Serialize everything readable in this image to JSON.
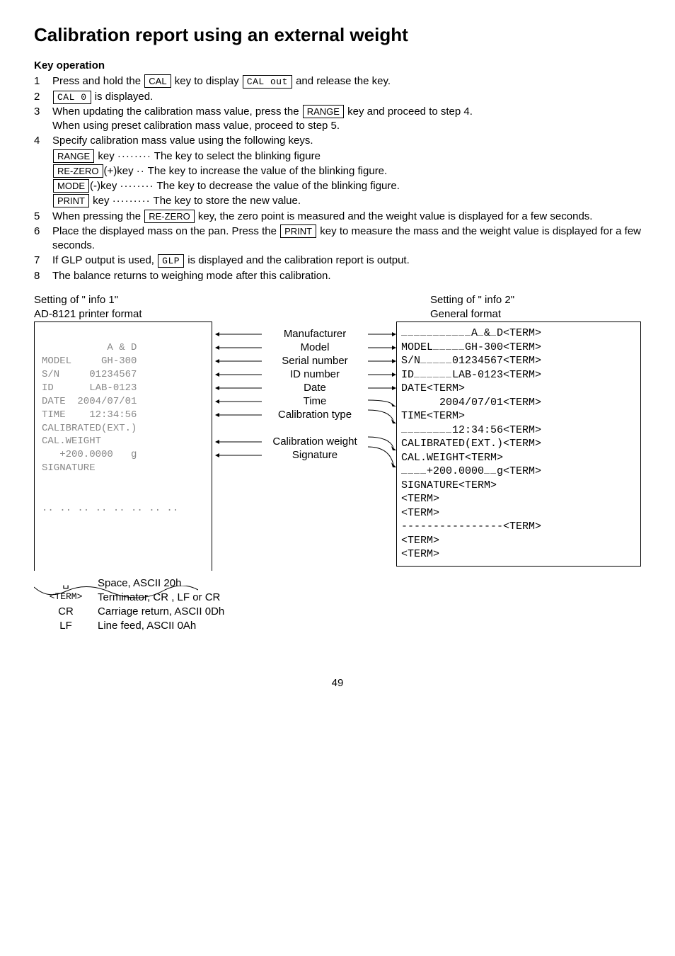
{
  "title": "Calibration report using an external weight",
  "keyop_heading": "Key operation",
  "steps": [
    {
      "n": "1",
      "prefix": "Press and hold the ",
      "box": "CAL",
      "mid": " key to display ",
      "box2": "CAL out",
      "suffix": " and release the key.",
      "seg2": true
    },
    {
      "n": "2",
      "box": "CAL 0",
      "suffix": " is displayed.",
      "seg": true
    },
    {
      "n": "3",
      "line1a": "When updating the calibration mass value, press the ",
      "box": "RANGE",
      "line1b": " key and proceed to step 4.",
      "line2": "When using preset calibration mass value, proceed to step 5."
    },
    {
      "n": "4",
      "line": "Specify calibration mass value using the following keys."
    },
    {
      "n": "5",
      "text": "When pressing the ",
      "box": "RE-ZERO",
      "text2": " key, the zero point is measured and the weight value is displayed for a few seconds.",
      "justify": true
    },
    {
      "n": "6",
      "text": "Place the displayed mass on the pan. Press the ",
      "box": "PRINT",
      "text2": " key to measure the mass and the weight value is displayed for a few seconds.",
      "justify": true
    },
    {
      "n": "7",
      "text": "If GLP output is used, ",
      "box": "GLP",
      "text2": " is displayed and the calibration report is output.",
      "segbox": true
    },
    {
      "n": "8",
      "text": "The balance returns to weighing mode after this calibration."
    }
  ],
  "step4_rows": [
    {
      "box": "RANGE",
      "kp": " key ",
      "dots": "········",
      "t": " The key to select the blinking figure"
    },
    {
      "box": "RE-ZERO",
      "kp": "(+)key ",
      "dots": "··",
      "t": " The key to increase the value of the blinking figure."
    },
    {
      "box": "MODE",
      "kp": "(-)key ",
      "dots": "········",
      "t": " The key to decrease the value of the blinking figure."
    },
    {
      "box": "PRINT",
      "kp": " key ",
      "dots": "·········",
      "t": " The key to store the new value."
    }
  ],
  "left_header_1": "Setting of \" info  1\"",
  "left_header_2": "AD-8121 printer format",
  "right_header_1": "Setting of \" info  2\"",
  "right_header_2": "General format",
  "printer_lines": [
    "           A & D",
    "MODEL     GH-300",
    "S/N     01234567",
    "ID      LAB-0123",
    "DATE  2004/07/01",
    "TIME    12:34:56",
    "CALIBRATED(EXT.)",
    "CAL.WEIGHT",
    "   +200.0000   g",
    "SIGNATURE",
    "",
    "",
    ".. .. .. .. .. .. .. .."
  ],
  "mid_labels": [
    "Manufacturer",
    "Model",
    "Serial number",
    "ID number",
    "Date",
    "Time",
    "Calibration type",
    "",
    "Calibration weight",
    "Signature"
  ],
  "right_lines": [
    "␣␣␣␣␣␣␣␣␣␣␣A␣&␣D<TERM>",
    "MODEL␣␣␣␣␣GH-300<TERM>",
    "S/N␣␣␣␣␣01234567<TERM>",
    "ID␣␣␣␣␣␣LAB-0123<TERM>",
    "DATE<TERM>",
    "      2004/07/01<TERM>",
    "TIME<TERM>",
    "␣␣␣␣␣␣␣␣12:34:56<TERM>",
    "CALIBRATED(EXT.)<TERM>",
    "CAL.WEIGHT<TERM>",
    "␣␣␣␣+200.0000␣␣g<TERM>",
    "SIGNATURE<TERM>",
    "<TERM>",
    "<TERM>",
    "----------------<TERM>",
    "<TERM>",
    "<TERM>"
  ],
  "legend": [
    {
      "sym": "␣",
      "desc": "Space, ASCII 20h"
    },
    {
      "sym": "<TERM>",
      "desc": "Terminator, CR , LF or CR"
    },
    {
      "sym": "CR",
      "desc": "Carriage return, ASCII 0Dh"
    },
    {
      "sym": "LF",
      "desc": "Line feed, ASCII 0Ah"
    }
  ],
  "page": "49"
}
